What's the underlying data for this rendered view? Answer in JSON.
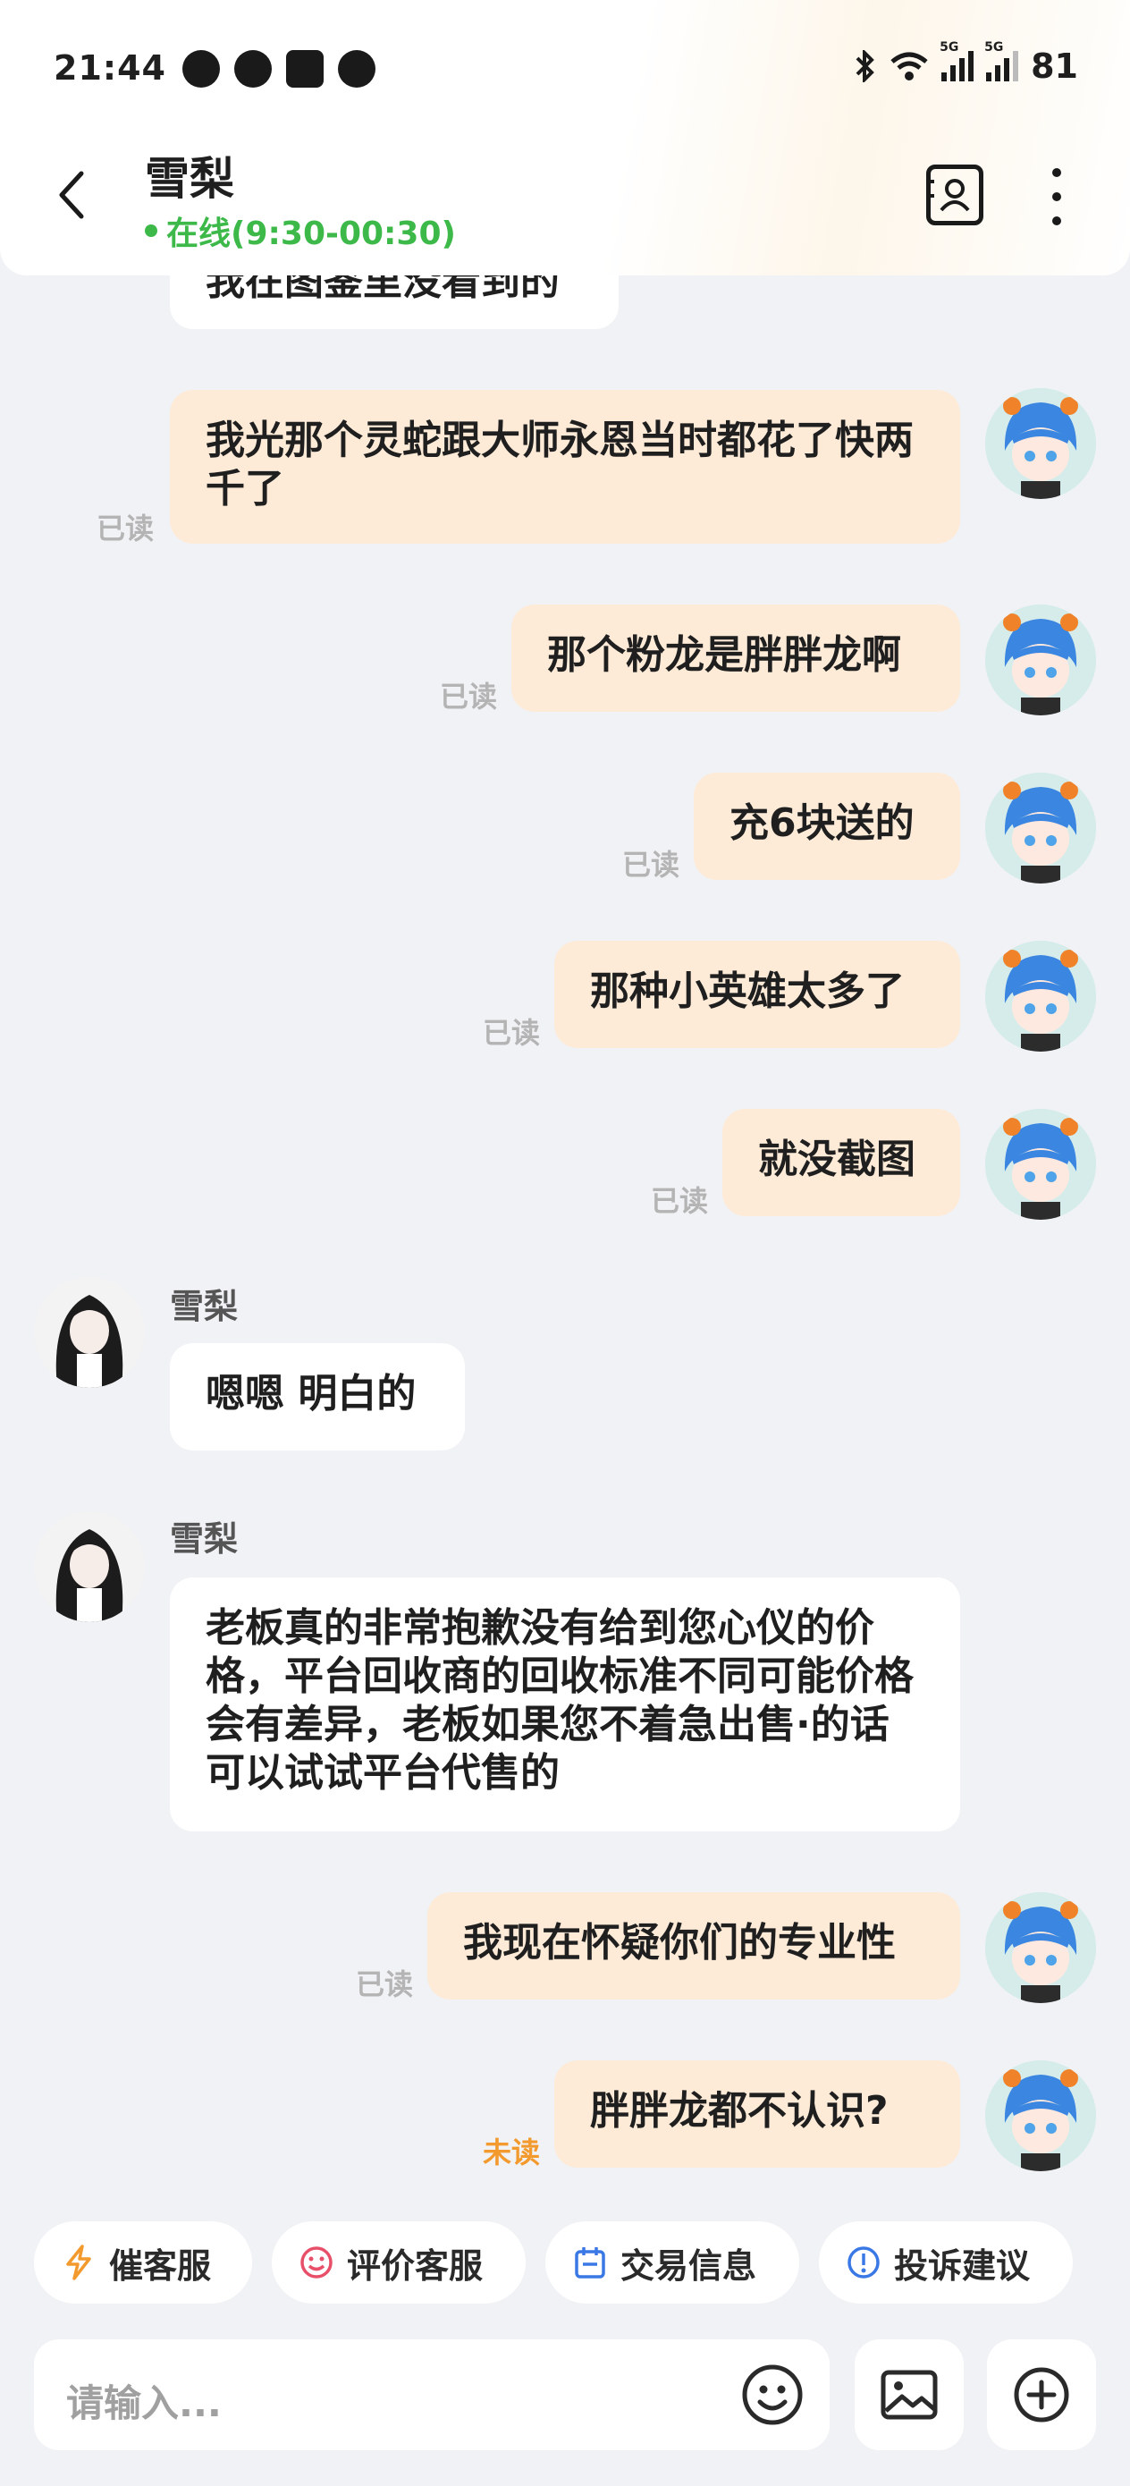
{
  "status_bar": {
    "time": "21:44",
    "battery": "81",
    "network_label_1": "5G",
    "network_label_2": "5G"
  },
  "header": {
    "contact_name": "雪梨",
    "online_status": "在线(9:30-00:30)"
  },
  "messages": [
    {
      "direction": "in",
      "text": "我在图鉴里没看到的"
    },
    {
      "direction": "out",
      "text": "我光那个灵蛇跟大师永恩当时都花了快两千了",
      "status": "已读"
    },
    {
      "direction": "out",
      "text": "那个粉龙是胖胖龙啊",
      "status": "已读"
    },
    {
      "direction": "out",
      "text": "充6块送的",
      "status": "已读"
    },
    {
      "direction": "out",
      "text": "那种小英雄太多了",
      "status": "已读"
    },
    {
      "direction": "out",
      "text": "就没截图",
      "status": "已读"
    },
    {
      "direction": "in",
      "sender": "雪梨",
      "text": "嗯嗯 明白的"
    },
    {
      "direction": "in",
      "sender": "雪梨",
      "text": "老板真的非常抱歉没有给到您心仪的价格，平台回收商的回收标准不同可能价格会有差异，老板如果您不着急出售·的话可以试试平台代售的"
    },
    {
      "direction": "out",
      "text": "我现在怀疑你们的专业性",
      "status": "已读"
    },
    {
      "direction": "out",
      "text": "胖胖龙都不认识?",
      "status": "未读"
    }
  ],
  "quick_actions": [
    {
      "label": "催客服",
      "icon": "lightning-icon",
      "color": "#f39a2e"
    },
    {
      "label": "评价客服",
      "icon": "smile-icon",
      "color": "#e8506a"
    },
    {
      "label": "交易信息",
      "icon": "calendar-icon",
      "color": "#3a78e6"
    },
    {
      "label": "投诉建议",
      "icon": "alert-icon",
      "color": "#3a78e6"
    }
  ],
  "composer": {
    "placeholder": "请输入..."
  }
}
